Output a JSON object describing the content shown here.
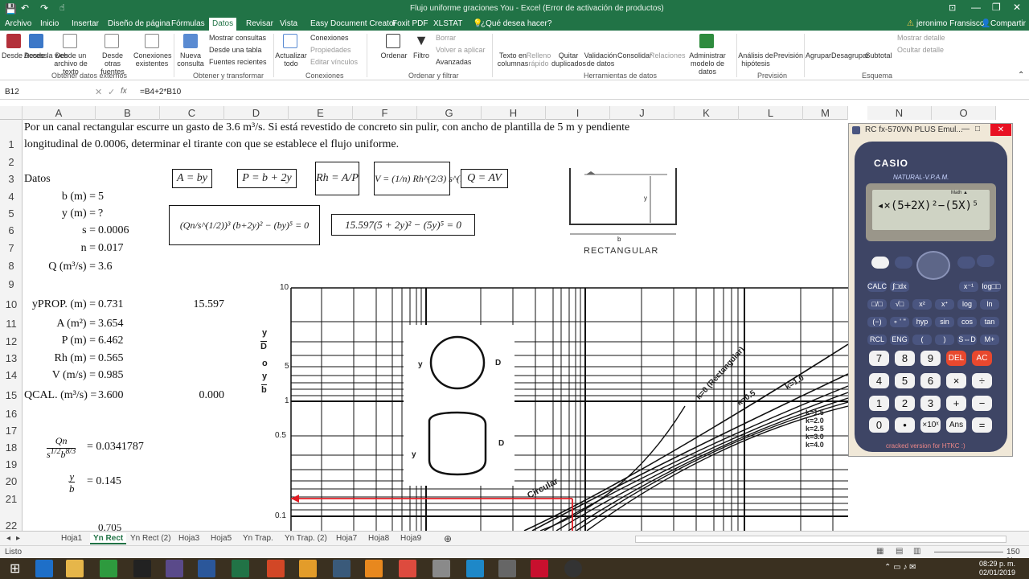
{
  "window": {
    "title": "Flujo uniforme graciones You - Excel (Error de activación de productos)"
  },
  "ribbon_tabs": [
    "Archivo",
    "Inicio",
    "Insertar",
    "Diseño de página",
    "Fórmulas",
    "Datos",
    "Revisar",
    "Vista",
    "Easy Document Creator",
    "Foxit PDF",
    "XLSTAT",
    "¿Qué desea hacer?"
  ],
  "user": "jeronimo Fransisco",
  "share": "Compartir",
  "ribbon": {
    "desde_access": "Desde Access",
    "desde_web": "Desde la web",
    "desde_texto": "Desde un archivo de texto",
    "otras_fuentes": "Desde otras fuentes",
    "conexiones_existentes": "Conexiones existentes",
    "nueva_consulta": "Nueva consulta",
    "mostrar_consultas": "Mostrar consultas",
    "desde_tabla": "Desde una tabla",
    "fuentes_recientes": "Fuentes recientes",
    "actualizar": "Actualizar todo",
    "conexiones": "Conexiones",
    "propiedades": "Propiedades",
    "editar_vinculos": "Editar vínculos",
    "ordenar": "Ordenar",
    "filtro": "Filtro",
    "borrar": "Borrar",
    "volver_aplicar": "Volver a aplicar",
    "avanzadas": "Avanzadas",
    "texto_columnas": "Texto en columnas",
    "relleno_rapido": "Relleno rápido",
    "quitar_duplicados": "Quitar duplicados",
    "validacion": "Validación de datos",
    "consolidar": "Consolidar",
    "relaciones": "Relaciones",
    "administrar": "Administrar modelo de datos",
    "analisis": "Análisis de hipótesis",
    "prevision": "Previsión",
    "agrupar": "Agrupar",
    "desagrupar": "Desagrupar",
    "subtotal": "Subtotal",
    "mostrar_detalle": "Mostrar detalle",
    "ocultar_detalle": "Ocultar detalle",
    "groups": [
      "Obtener datos externos",
      "Obtener y transformar",
      "Conexiones",
      "Ordenar y filtrar",
      "Herramientas de datos",
      "Previsión",
      "Esquema"
    ]
  },
  "formula_bar": {
    "name_box": "B12",
    "formula": "=B4+2*B10"
  },
  "columns": [
    "A",
    "B",
    "C",
    "D",
    "E",
    "F",
    "G",
    "H",
    "I",
    "J",
    "K",
    "L",
    "M",
    "N",
    "O"
  ],
  "rows": [
    "1",
    "2",
    "3",
    "4",
    "5",
    "6",
    "7",
    "8",
    "9",
    "10",
    "11",
    "12",
    "13",
    "14",
    "15",
    "16",
    "17",
    "18",
    "19",
    "20",
    "21",
    "22"
  ],
  "problem": {
    "line1": "Por un canal rectangular escurre un gasto de 3.6 m³/s.  Si está revestido de concreto sin pulir, con ancho de plantilla de 5 m y pendiente",
    "line2": "longitudinal de 0.0006, determinar el tirante con que se establece el flujo uniforme."
  },
  "sheet": {
    "datos": "Datos",
    "b_label": "b (m) =",
    "b_val": "5",
    "y_label": "y (m) =",
    "y_val": "?",
    "s_label": "s =",
    "s_val": "0.0006",
    "n_label": "n =",
    "n_val": "0.017",
    "q_label": "Q (m³/s) =",
    "q_val": "3.6",
    "yprop_label": "yPROP. (m) =",
    "yprop_val": "0.731",
    "c10": "15.597",
    "a_label": "A (m²) =",
    "a_val": "3.654",
    "p_label": "P (m) =",
    "p_val": "6.462",
    "rh_label": "Rh (m) =",
    "rh_val": "0.565",
    "v_label": "V (m/s) =",
    "v_val": "0.985",
    "qcal_label": "QCAL. (m³/s) =",
    "qcal_val": "3.600",
    "c15": "0.000",
    "r18_val": "= 0.0341787",
    "r20_val": "= 0.145",
    "r22_partial": "0.705"
  },
  "formulas": {
    "f1": "A = by",
    "f2": "P = b + 2y",
    "f3": "Rh = A/P",
    "f4": "V = (1/n) Rh^(2/3) s^(1/2)",
    "f5": "Q = AV",
    "f6": "(Qn/s^(1/2))³ (b+2y)² − (by)⁵ = 0",
    "f7": "15.597(5 + 2y)² − (5y)⁵ = 0"
  },
  "diagram": {
    "caption": "RECTANGULAR",
    "y": "y",
    "b": "b"
  },
  "chart": {
    "yticks": [
      "10",
      "5",
      "1",
      "0.5",
      "0.1"
    ],
    "axis_label": [
      "y",
      "D",
      "o",
      "y",
      "b"
    ],
    "curves": [
      "k=0 (Rectangular)",
      "k=0.5",
      "k=1.0",
      "k=1.5",
      "k=2.0",
      "k=2.5",
      "k=3.0",
      "k=4.0",
      "Circular"
    ],
    "d_label": "D",
    "y_label": "y"
  },
  "calculator": {
    "title": "RC fx-570VN PLUS Emul...",
    "brand": "CASIO",
    "model": "NATURAL-V.P.A.M.",
    "display": "◂×(5+2X)²−(5X)⁵",
    "math": "Math ▲",
    "footer": "cracked version for HTKC :)",
    "rows": [
      [
        "7",
        "8",
        "9",
        "DEL",
        "AC"
      ],
      [
        "4",
        "5",
        "6",
        "×",
        "÷"
      ],
      [
        "1",
        "2",
        "3",
        "+",
        "−"
      ],
      [
        "0",
        "•",
        "×10ˣ",
        "Ans",
        "="
      ]
    ],
    "fn_rows": [
      [
        "CALC",
        "∫□dx",
        "x⁻¹",
        "log□□"
      ],
      [
        "□/□",
        "√□",
        "x²",
        "xᐩ",
        "log",
        "ln"
      ],
      [
        "(−)",
        "∘ ' ''",
        "hyp",
        "sin",
        "cos",
        "tan"
      ],
      [
        "RCL",
        "ENG",
        "(",
        ")",
        "S⇔D",
        "M+"
      ]
    ]
  },
  "sheet_tabs": [
    "Hoja1",
    "Yn Rect",
    "Yn Rect (2)",
    "Hoja3",
    "Hoja5",
    "Yn Trap.",
    "Yn Trap. (2)",
    "Hoja7",
    "Hoja8",
    "Hoja9"
  ],
  "status": {
    "mode": "Listo",
    "zoom": "150 %"
  },
  "taskbar": {
    "time": "08:29 p. m.",
    "date": "02/01/2019"
  }
}
